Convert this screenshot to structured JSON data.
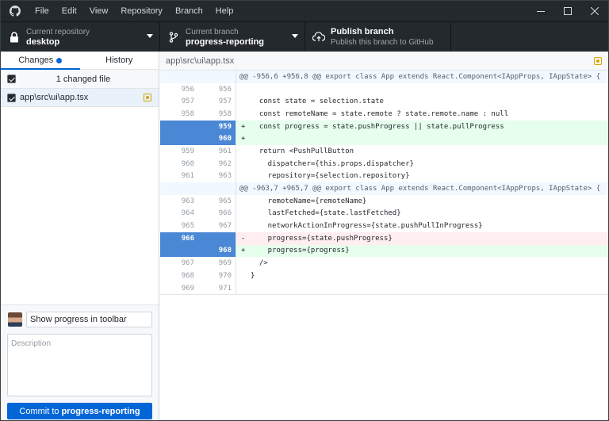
{
  "menus": [
    "File",
    "Edit",
    "View",
    "Repository",
    "Branch",
    "Help"
  ],
  "toolbar": {
    "repo_label": "Current repository",
    "repo_value": "desktop",
    "branch_label": "Current branch",
    "branch_value": "progress-reporting",
    "publish_label": "Publish branch",
    "publish_desc": "Publish this branch to GitHub"
  },
  "sidebar": {
    "tab_changes": "Changes",
    "tab_history": "History",
    "changed_count": "1 changed file",
    "file_path": "app\\src\\ui\\app.tsx",
    "commit": {
      "summary": "Show progress in toolbar",
      "description_placeholder": "Description",
      "button_prefix": "Commit to",
      "button_branch": "progress-reporting"
    }
  },
  "diff": {
    "path": "app\\src\\ui\\app.tsx",
    "lines": [
      {
        "type": "hunk",
        "old": "",
        "new": "",
        "marker": "",
        "text": "@@ -956,6 +956,8 @@ export class App extends React.Component<IAppProps, IAppState> {"
      },
      {
        "type": "ctx",
        "old": "956",
        "new": "956",
        "marker": "",
        "text": ""
      },
      {
        "type": "ctx",
        "old": "957",
        "new": "957",
        "marker": "",
        "text": "  const state = selection.state"
      },
      {
        "type": "ctx",
        "old": "958",
        "new": "958",
        "marker": "",
        "text": "  const remoteName = state.remote ? state.remote.name : null"
      },
      {
        "type": "add",
        "old": "",
        "new": "959",
        "marker": "+",
        "text": "  const progress = state.pushProgress || state.pullProgress"
      },
      {
        "type": "add",
        "old": "",
        "new": "960",
        "marker": "+",
        "text": ""
      },
      {
        "type": "ctx",
        "old": "959",
        "new": "961",
        "marker": "",
        "text": "  return <PushPullButton"
      },
      {
        "type": "ctx",
        "old": "960",
        "new": "962",
        "marker": "",
        "text": "    dispatcher={this.props.dispatcher}"
      },
      {
        "type": "ctx",
        "old": "961",
        "new": "963",
        "marker": "",
        "text": "    repository={selection.repository}"
      },
      {
        "type": "hunk",
        "old": "",
        "new": "",
        "marker": "",
        "text": "@@ -963,7 +965,7 @@ export class App extends React.Component<IAppProps, IAppState> {"
      },
      {
        "type": "ctx",
        "old": "963",
        "new": "965",
        "marker": "",
        "text": "    remoteName={remoteName}"
      },
      {
        "type": "ctx",
        "old": "964",
        "new": "966",
        "marker": "",
        "text": "    lastFetched={state.lastFetched}"
      },
      {
        "type": "ctx",
        "old": "965",
        "new": "967",
        "marker": "",
        "text": "    networkActionInProgress={state.pushPullInProgress}"
      },
      {
        "type": "del",
        "old": "966",
        "new": "",
        "marker": "-",
        "text": "    progress={state.pushProgress}"
      },
      {
        "type": "add",
        "old": "",
        "new": "968",
        "marker": "+",
        "text": "    progress={progress}"
      },
      {
        "type": "ctx",
        "old": "967",
        "new": "969",
        "marker": "",
        "text": "  />"
      },
      {
        "type": "ctx",
        "old": "968",
        "new": "970",
        "marker": "",
        "text": "}"
      },
      {
        "type": "ctx",
        "old": "969",
        "new": "971",
        "marker": "",
        "text": ""
      }
    ]
  },
  "colors": {
    "titlebar": "#24292e",
    "accent": "#0366d6",
    "added_bg": "#e6ffed",
    "removed_bg": "#ffeef0",
    "hunk_bg": "#f1f8ff",
    "gutter_selected": "#4a87d4"
  },
  "icons": [
    "github-logo-icon",
    "lock-icon",
    "branch-icon",
    "cloud-upload-icon",
    "minimize-icon",
    "maximize-icon",
    "close-icon"
  ]
}
